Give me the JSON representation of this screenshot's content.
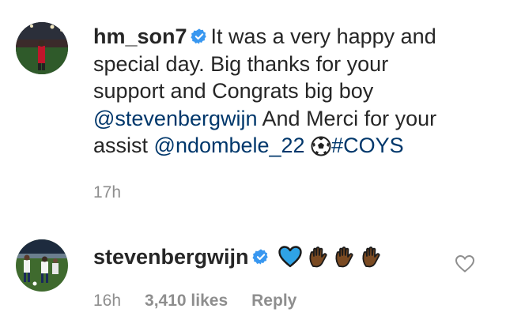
{
  "comments": [
    {
      "username": "hm_son7",
      "verified": true,
      "text_line1": "It was a very happy and",
      "text_line2": "special day. Big thanks for your",
      "text_line3": "support and Congrats big boy",
      "mention1": "@stevenbergwijn",
      "text_line4_rest": " And Merci for your",
      "text_line5_start": "assist ",
      "mention2": "@ndombele_22",
      "emoji": "soccer-ball-icon",
      "hashtag": "#COYS",
      "time": "17h"
    },
    {
      "username": "stevenbergwijn",
      "verified": true,
      "emojis": [
        "blue-heart-icon",
        "raised-hand-icon",
        "raised-hand-icon",
        "raised-hand-icon"
      ],
      "time": "16h",
      "likes": "3,410 likes",
      "reply": "Reply"
    }
  ],
  "colors": {
    "text": "#262626",
    "link": "#00376b",
    "meta": "#8e8e8e",
    "verified": "#3897f0"
  }
}
